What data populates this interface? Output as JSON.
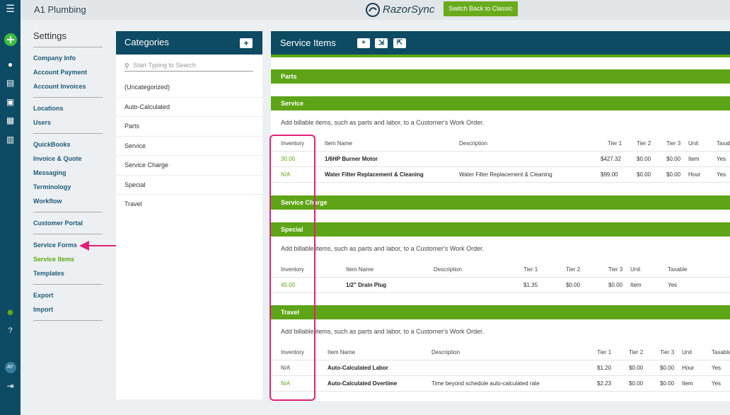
{
  "header": {
    "company": "A1 Plumbing",
    "logo_text": "RazorSync",
    "switch_label": "Switch Back to Classic"
  },
  "rail": {
    "avatar": "AY"
  },
  "settings": {
    "title": "Settings",
    "groups": [
      [
        "Company Info",
        "Account Payment",
        "Account Invoices"
      ],
      [
        "Locations",
        "Users"
      ],
      [
        "QuickBooks",
        "Invoice & Quote",
        "Messaging",
        "Terminology",
        "Workflow"
      ],
      [
        "Customer Portal"
      ],
      [
        "Service Forms",
        "Service Items",
        "Templates"
      ],
      [
        "Export",
        "Import"
      ]
    ],
    "active": "Service Items"
  },
  "categories": {
    "title": "Categories",
    "add": "+",
    "search_placeholder": "Start Typing to Search",
    "items": [
      "(Uncategorized)",
      "Auto-Calculated",
      "Parts",
      "Service",
      "Service Charge",
      "Special",
      "Travel"
    ]
  },
  "service_items": {
    "title": "Service Items",
    "hint": "Add billable items, such as parts and labor, to a Customer's Work Order.",
    "sections": {
      "parts": "Parts",
      "service": "Service",
      "service_charge": "Service Charge",
      "special": "Special",
      "travel": "Travel"
    },
    "columns": [
      "Inventory",
      "Item Name",
      "Description",
      "Tier 1",
      "Tier 2",
      "Tier 3",
      "Unit",
      "Taxable"
    ],
    "service_rows": [
      {
        "inventory": "30.00",
        "name": "1/6HP Burner Motor",
        "description": "",
        "tier1": "$427.32",
        "tier2": "$0.00",
        "tier3": "$0.00",
        "unit": "Item",
        "taxable": "Yes"
      },
      {
        "inventory": "N/A",
        "name": "Water Filter Replacement & Cleaning",
        "description": "Water Filter Replacement & Cleaning",
        "tier1": "$99.00",
        "tier2": "$0.00",
        "tier3": "$0.00",
        "unit": "Hour",
        "taxable": "Yes"
      }
    ],
    "special_rows": [
      {
        "inventory": "45.00",
        "name": "1/2\" Drain Plug",
        "description": "",
        "tier1": "$1.35",
        "tier2": "$0.00",
        "tier3": "$0.00",
        "unit": "Item",
        "taxable": "Yes"
      }
    ],
    "travel_rows": [
      {
        "inventory": "N/A",
        "name": "Auto-Calculated Labor",
        "description": "",
        "tier1": "$1.20",
        "tier2": "$0.00",
        "tier3": "$0.00",
        "unit": "Hour",
        "taxable": "Yes"
      },
      {
        "inventory": "N/A",
        "name": "Auto-Calculated Overtime",
        "description": "Time beyond schedule auto-calculated rate",
        "tier1": "$2.23",
        "tier2": "$0.00",
        "tier3": "$0.00",
        "unit": "Item",
        "taxable": "Yes"
      }
    ]
  },
  "colors": {
    "accent": "#5da516",
    "navy": "#0d4a63",
    "highlight": "#e0207a"
  }
}
